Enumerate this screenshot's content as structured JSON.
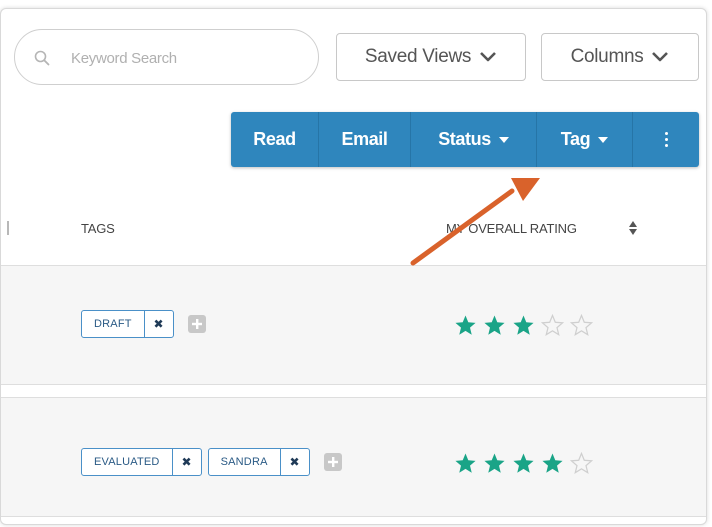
{
  "search": {
    "placeholder": "Keyword Search",
    "value": ""
  },
  "views": {
    "saved_label": "Saved Views",
    "columns_label": "Columns"
  },
  "toolbar": {
    "read": "Read",
    "email": "Email",
    "status": "Status",
    "tag": "Tag"
  },
  "table": {
    "headers": {
      "tags": "TAGS",
      "rating": "MY OVERALL RATING"
    },
    "rows": [
      {
        "tags": [
          "DRAFT"
        ],
        "rating": 3,
        "max_rating": 5
      },
      {
        "tags": [
          "EVALUATED",
          "SANDRA"
        ],
        "rating": 4,
        "max_rating": 5
      }
    ]
  },
  "colors": {
    "toolbar": "#2f86bd",
    "star_filled": "#1aa487",
    "star_empty": "#cfcfcf",
    "tag_border": "#4a90c8",
    "arrow": "#d9622b"
  },
  "icons": {
    "search": "search-icon",
    "chevron": "chevron-down-icon",
    "caret": "caret-down-icon",
    "more": "more-vertical-icon",
    "remove_tag": "close-icon",
    "add_tag": "plus-square-icon",
    "sort": "sort-icon",
    "star": "star-icon",
    "annotation": "arrow-annotation-icon"
  }
}
